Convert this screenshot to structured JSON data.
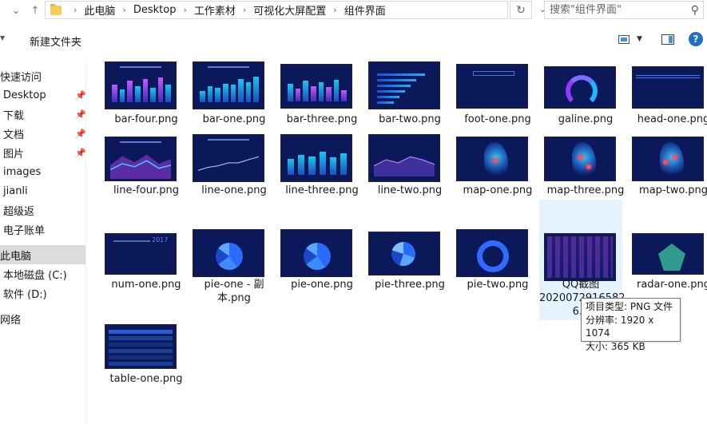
{
  "address": {
    "crumbs": [
      "此电脑",
      "Desktop",
      "工作素材",
      "可视化大屏配置",
      "组件界面"
    ]
  },
  "search": {
    "placeholder": "搜索\"组件界面\""
  },
  "commandbar": {
    "new_folder": "新建文件夹"
  },
  "sidebar": {
    "items": [
      {
        "label": "快速访问"
      },
      {
        "label": "Desktop",
        "pinned": true
      },
      {
        "label": "下载",
        "pinned": true
      },
      {
        "label": "文档",
        "pinned": true
      },
      {
        "label": "图片",
        "pinned": true
      },
      {
        "label": "images"
      },
      {
        "label": "jianli"
      },
      {
        "label": "超级返"
      },
      {
        "label": "电子账单"
      },
      {
        "label": "此电脑",
        "selected": true
      },
      {
        "label": "本地磁盘 (C:)"
      },
      {
        "label": "软件 (D:)"
      },
      {
        "label": "网络"
      }
    ]
  },
  "files": [
    {
      "name": "bar-four.png",
      "kind": "bar-purple"
    },
    {
      "name": "bar-one.png",
      "kind": "bar"
    },
    {
      "name": "bar-three.png",
      "kind": "bar-mixed"
    },
    {
      "name": "bar-two.png",
      "kind": "hbar"
    },
    {
      "name": "foot-one.png",
      "kind": "foot"
    },
    {
      "name": "galine.png",
      "kind": "gauge"
    },
    {
      "name": "head-one.png",
      "kind": "head"
    },
    {
      "name": "line-four.png",
      "kind": "line-multi"
    },
    {
      "name": "line-one.png",
      "kind": "line"
    },
    {
      "name": "line-three.png",
      "kind": "bar-line"
    },
    {
      "name": "line-two.png",
      "kind": "line-area"
    },
    {
      "name": "map-one.png",
      "kind": "map"
    },
    {
      "name": "map-three.png",
      "kind": "map"
    },
    {
      "name": "map-two.png",
      "kind": "map"
    },
    {
      "name": "num-one.png",
      "kind": "num"
    },
    {
      "name": "pie-one - 副本.png",
      "kind": "pie"
    },
    {
      "name": "pie-one.png",
      "kind": "pie"
    },
    {
      "name": "pie-three.png",
      "kind": "pie-multi"
    },
    {
      "name": "pie-two.png",
      "kind": "ring"
    },
    {
      "name": "QQ截图20200729165826.png",
      "kind": "qq",
      "display": "QQ截图\n2020072916582\n6.p",
      "hovered": true
    },
    {
      "name": "radar-one.png",
      "kind": "radar"
    },
    {
      "name": "table-one.png",
      "kind": "table"
    }
  ],
  "tooltip": {
    "line1": "项目类型: PNG 文件",
    "line2": "分辨率: 1920 x 1074",
    "line3": "大小: 365 KB"
  },
  "num_thumb_text": "2017"
}
